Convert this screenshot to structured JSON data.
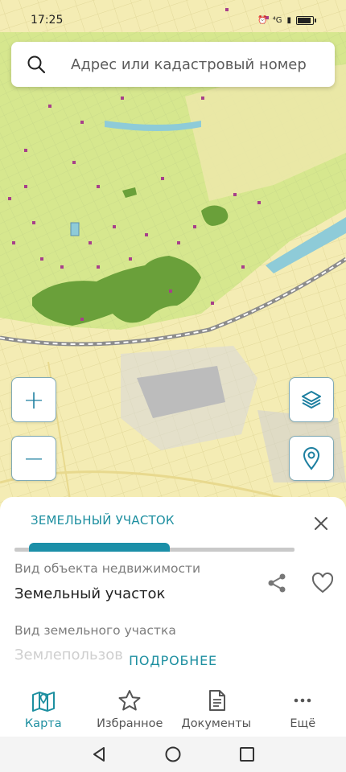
{
  "status_bar": {
    "time": "17:25",
    "signal_text": "⁴G"
  },
  "search": {
    "placeholder": "Адрес или кадастровый номер",
    "icon": "search-icon"
  },
  "map": {
    "zoom_in_label": "+",
    "zoom_out_label": "−",
    "layers_icon": "layers-icon",
    "location_icon": "location-pin-icon",
    "colors": {
      "base": "#f4ecb1",
      "zone": "#d8e891",
      "forest": "#6aa03a",
      "water": "#8ecbd8",
      "railway": "#8c8c8c",
      "building": "#a73f8a"
    }
  },
  "sheet": {
    "tab_label": "ЗЕМЕЛЬНЫЙ УЧАСТОК",
    "field1_label": "Вид объекта недвижимости",
    "field1_value": "Земельный участок",
    "field2_label": "Вид земельного участка",
    "field2_value_partial": "Землепользов",
    "more_label": "ПОДРОБНЕЕ",
    "accent": "#1d8fa0"
  },
  "bottom_nav": {
    "items": [
      {
        "label": "Карта",
        "icon": "map-icon",
        "active": true
      },
      {
        "label": "Избранное",
        "icon": "star-icon",
        "active": false
      },
      {
        "label": "Документы",
        "icon": "document-icon",
        "active": false
      },
      {
        "label": "Ещё",
        "icon": "more-icon",
        "active": false
      }
    ]
  }
}
